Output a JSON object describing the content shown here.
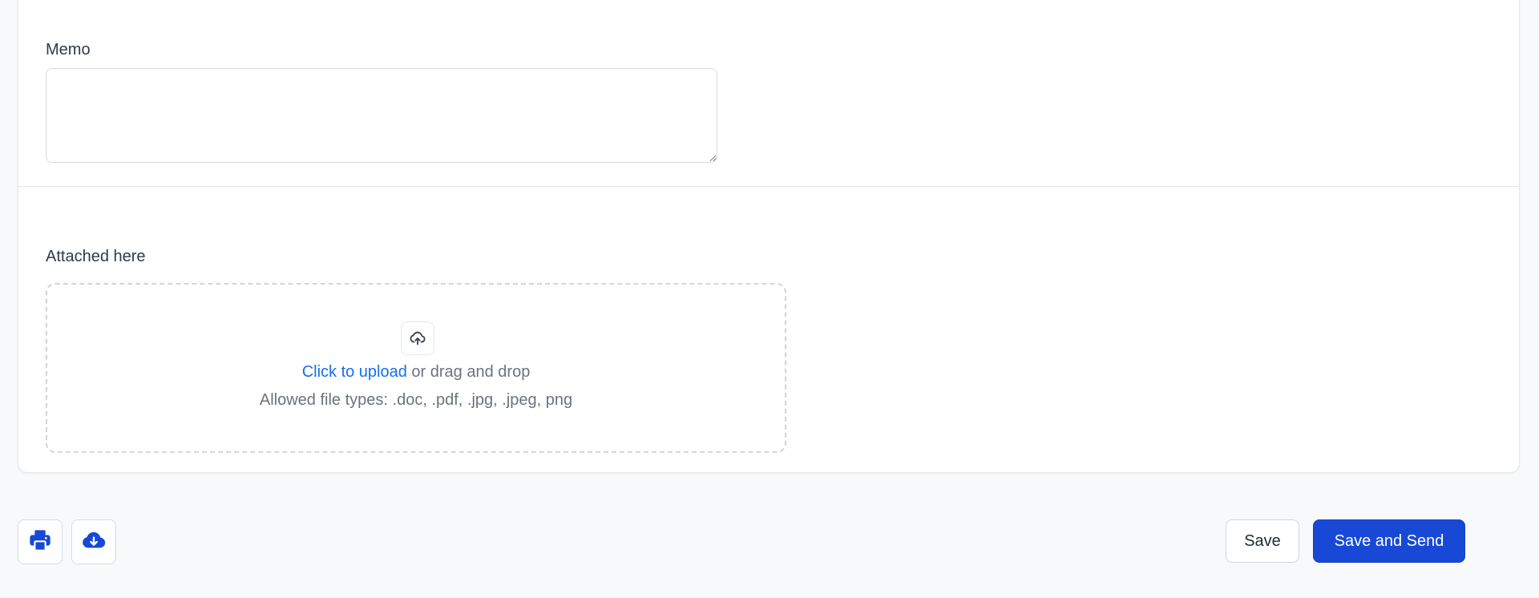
{
  "memo": {
    "label": "Memo",
    "value": ""
  },
  "attachments": {
    "label": "Attached here",
    "upload_link": "Click to upload",
    "upload_rest": " or drag and drop",
    "allowed_types": "Allowed file types: .doc, .pdf, .jpg, .jpeg, png",
    "icon": "cloud-upload-icon"
  },
  "footer": {
    "print_icon": "printer-icon",
    "download_icon": "cloud-download-icon",
    "save_label": "Save",
    "save_send_label": "Save and Send"
  },
  "colors": {
    "primary": "#1849d6",
    "link": "#1570ef",
    "background": "#f8f9fb"
  }
}
